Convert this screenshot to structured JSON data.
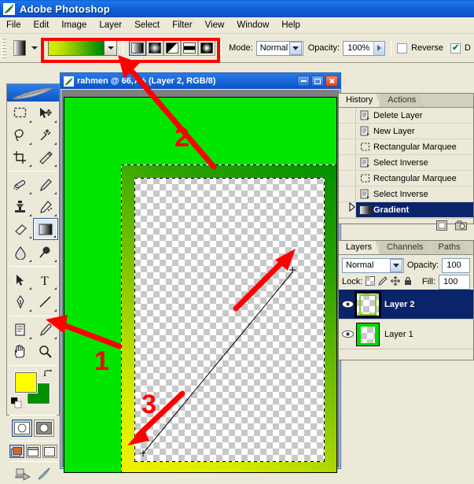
{
  "app": {
    "title": "Adobe Photoshop",
    "logo_icon": "photoshop-feather-icon",
    "menu": [
      "File",
      "Edit",
      "Image",
      "Layer",
      "Select",
      "Filter",
      "View",
      "Window",
      "Help"
    ]
  },
  "options_bar": {
    "tool_preset_icon": "gradient-tool-preset-icon",
    "preset_dropdown_icon": "chevron-down-icon",
    "gradient_swatch": {
      "name": "gradient-preview",
      "from": "#d8ec00",
      "mid": "#7ec000",
      "to": "#009000"
    },
    "gradient_picker_icon": "chevron-down-icon",
    "gradient_types": [
      {
        "name": "linear-gradient-type",
        "label": "Linear Gradient",
        "selected": true
      },
      {
        "name": "radial-gradient-type",
        "label": "Radial Gradient",
        "selected": false
      },
      {
        "name": "angle-gradient-type",
        "label": "Angle Gradient",
        "selected": false
      },
      {
        "name": "reflected-gradient-type",
        "label": "Reflected Gradient",
        "selected": false
      },
      {
        "name": "diamond-gradient-type",
        "label": "Diamond Gradient",
        "selected": false
      }
    ],
    "mode_label": "Mode:",
    "mode_value": "Normal",
    "opacity_label": "Opacity:",
    "opacity_value": "100%",
    "reverse_label": "Reverse",
    "reverse_checked": false,
    "dither_label": "D",
    "dither_checked": true
  },
  "toolbox": {
    "tools": [
      {
        "name": "rectangular-marquee-tool",
        "label": "Rectangular Marquee",
        "selected": false
      },
      {
        "name": "move-tool",
        "label": "Move",
        "selected": false
      },
      {
        "name": "lasso-tool",
        "label": "Lasso",
        "selected": false
      },
      {
        "name": "magic-wand-tool",
        "label": "Magic Wand",
        "selected": false
      },
      {
        "name": "crop-tool",
        "label": "Crop",
        "selected": false
      },
      {
        "name": "slice-tool",
        "label": "Slice",
        "selected": false
      },
      {
        "name": "healing-brush-tool",
        "label": "Healing Brush",
        "selected": false
      },
      {
        "name": "brush-tool",
        "label": "Brush",
        "selected": false
      },
      {
        "name": "clone-stamp-tool",
        "label": "Clone Stamp",
        "selected": false
      },
      {
        "name": "history-brush-tool",
        "label": "History Brush",
        "selected": false
      },
      {
        "name": "eraser-tool",
        "label": "Eraser",
        "selected": false
      },
      {
        "name": "gradient-tool",
        "label": "Gradient",
        "selected": true
      },
      {
        "name": "blur-tool",
        "label": "Blur",
        "selected": false
      },
      {
        "name": "dodge-tool",
        "label": "Dodge",
        "selected": false
      },
      {
        "name": "path-selection-tool",
        "label": "Path Selection",
        "selected": false
      },
      {
        "name": "type-tool",
        "label": "Type",
        "selected": false
      },
      {
        "name": "pen-tool",
        "label": "Pen",
        "selected": false
      },
      {
        "name": "line-tool",
        "label": "Line",
        "selected": false
      },
      {
        "name": "notes-tool",
        "label": "Notes",
        "selected": false
      },
      {
        "name": "eyedropper-tool",
        "label": "Eyedropper",
        "selected": false
      },
      {
        "name": "hand-tool",
        "label": "Hand",
        "selected": false
      },
      {
        "name": "zoom-tool",
        "label": "Zoom",
        "selected": false
      }
    ],
    "foreground_color": "#ffff00",
    "background_color": "#009000",
    "swap_colors_icon": "swap-colors-icon",
    "default_colors_icon": "default-colors-icon",
    "quickmask": [
      {
        "name": "standard-mode-button",
        "selected": true
      },
      {
        "name": "quick-mask-mode-button",
        "selected": false
      }
    ],
    "screenmodes": [
      {
        "name": "standard-screen-mode-button",
        "selected": true
      },
      {
        "name": "full-screen-menubar-mode-button",
        "selected": false
      },
      {
        "name": "full-screen-mode-button",
        "selected": false
      }
    ],
    "jump_to": [
      {
        "name": "jump-to-imageready-button"
      },
      {
        "name": "imageready-icon"
      }
    ]
  },
  "document": {
    "icon": "document-icon",
    "title": "rahmen @ 66,7% (Layer 2, RGB/8)",
    "window_buttons": [
      {
        "name": "doc-minimize-button",
        "glyph": "minimize"
      },
      {
        "name": "doc-maximize-button",
        "glyph": "maximize"
      },
      {
        "name": "doc-close-button",
        "glyph": "close"
      }
    ],
    "canvas": {
      "background_color": "#00e000",
      "frame_gradient_from": "#f2f200",
      "frame_gradient_to": "#009000",
      "transparent_checker": "checkerboard",
      "selection": "marching-ants",
      "gradient_drag_line": "gradient-drag-line",
      "cursor": "crosshair-cursor"
    }
  },
  "history_panel": {
    "tabs": [
      {
        "name": "tab-history",
        "label": "History",
        "active": true
      },
      {
        "name": "tab-actions",
        "label": "Actions",
        "active": false
      }
    ],
    "states": [
      {
        "label": "Delete Layer",
        "icon": "history-state-icon",
        "selected": false
      },
      {
        "label": "New Layer",
        "icon": "history-state-icon",
        "selected": false
      },
      {
        "label": "Rectangular Marquee",
        "icon": "marquee-state-icon",
        "selected": false
      },
      {
        "label": "Select Inverse",
        "icon": "history-state-icon",
        "selected": false
      },
      {
        "label": "Rectangular Marquee",
        "icon": "marquee-state-icon",
        "selected": false
      },
      {
        "label": "Select Inverse",
        "icon": "history-state-icon",
        "selected": false
      },
      {
        "label": "Gradient",
        "icon": "gradient-state-icon",
        "selected": true
      }
    ],
    "footer_buttons": [
      {
        "name": "new-document-from-state-button",
        "icon": "new-document-icon"
      },
      {
        "name": "create-snapshot-button",
        "icon": "camera-icon"
      }
    ]
  },
  "layers_panel": {
    "tabs": [
      {
        "name": "tab-layers",
        "label": "Layers",
        "active": true
      },
      {
        "name": "tab-channels",
        "label": "Channels",
        "active": false
      },
      {
        "name": "tab-paths",
        "label": "Paths",
        "active": false
      }
    ],
    "blend_mode": "Normal",
    "opacity_label": "Opacity:",
    "opacity_value": "100",
    "lock_label": "Lock:",
    "lock_icons": [
      "lock-transparency-icon",
      "lock-image-icon",
      "lock-position-icon",
      "lock-all-icon"
    ],
    "fill_label": "Fill:",
    "fill_value": "100",
    "layers": [
      {
        "name": "Layer 2",
        "visible": true,
        "selected": true
      },
      {
        "name": "Layer 1",
        "visible": true,
        "selected": false
      }
    ],
    "visibility_icon": "eye-icon"
  },
  "annotations": {
    "accent_color": "#ff0000",
    "markers": [
      {
        "label": "1",
        "name": "annotation-marker-1",
        "points_to": "foreground-background-color-swatches"
      },
      {
        "label": "2",
        "name": "annotation-marker-2",
        "points_to": "gradient-options-bar"
      },
      {
        "label": "3",
        "name": "annotation-marker-3",
        "points_to": "gradient-drag-direction"
      }
    ],
    "highlight_boxes": [
      {
        "name": "options-bar-highlight-box"
      }
    ]
  }
}
